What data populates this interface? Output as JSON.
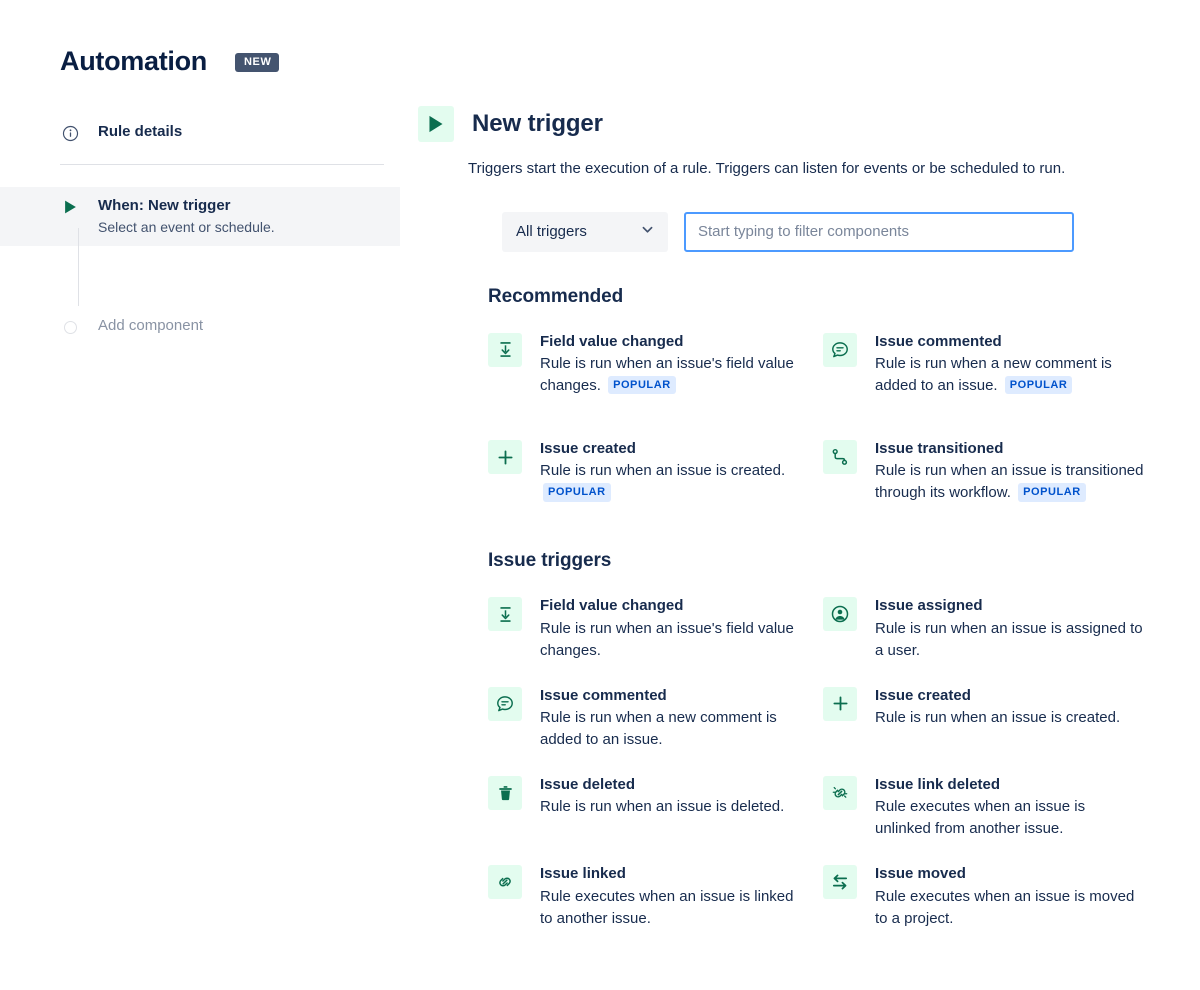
{
  "sidebar": {
    "app_title": "Automation",
    "new_badge": "NEW",
    "rule_details": {
      "label": "Rule details",
      "icon": "info-circle-icon"
    },
    "when_node": {
      "title": "When: New trigger",
      "subtitle": "Select an event or schedule.",
      "icon": "play-triangle-icon"
    },
    "add_component": {
      "label": "Add component",
      "icon": "empty-circle-icon"
    }
  },
  "main": {
    "title": "New trigger",
    "icon": "play-triangle-icon",
    "description": "Triggers start the execution of a rule. Triggers can listen for events or be scheduled to run.",
    "filter": {
      "select_value": "All triggers",
      "select_icon": "chevron-down-icon",
      "search_placeholder": "Start typing to filter components",
      "search_value": ""
    },
    "sections": [
      {
        "title": "Recommended",
        "items": [
          {
            "title": "Field value changed",
            "desc": "Rule is run when an issue's field value changes.",
            "badge": "POPULAR",
            "icon": "field-value-changed-icon"
          },
          {
            "title": "Issue commented",
            "desc": "Rule is run when a new comment is added to an issue.",
            "badge": "POPULAR",
            "icon": "comment-icon"
          },
          {
            "title": "Issue created",
            "desc": "Rule is run when an issue is created.",
            "badge": "POPULAR",
            "icon": "plus-icon"
          },
          {
            "title": "Issue transitioned",
            "desc": "Rule is run when an issue is transitioned through its workflow.",
            "badge": "POPULAR",
            "icon": "transition-icon"
          }
        ]
      },
      {
        "title": "Issue triggers",
        "items": [
          {
            "title": "Field value changed",
            "desc": "Rule is run when an issue's field value changes.",
            "badge": "",
            "icon": "field-value-changed-icon"
          },
          {
            "title": "Issue assigned",
            "desc": "Rule is run when an issue is assigned to a user.",
            "badge": "",
            "icon": "person-circle-icon"
          },
          {
            "title": "Issue commented",
            "desc": "Rule is run when a new comment is added to an issue.",
            "badge": "",
            "icon": "comment-icon"
          },
          {
            "title": "Issue created",
            "desc": "Rule is run when an issue is created.",
            "badge": "",
            "icon": "plus-icon"
          },
          {
            "title": "Issue deleted",
            "desc": "Rule is run when an issue is deleted.",
            "badge": "",
            "icon": "trash-icon"
          },
          {
            "title": "Issue link deleted",
            "desc": "Rule executes when an issue is unlinked from another issue.",
            "badge": "",
            "icon": "broken-link-icon"
          },
          {
            "title": "Issue linked",
            "desc": "Rule executes when an issue is linked to another issue.",
            "badge": "",
            "icon": "link-icon"
          },
          {
            "title": "Issue moved",
            "desc": "Rule executes when an issue is moved to a project.",
            "badge": "",
            "icon": "move-arrows-icon"
          }
        ]
      }
    ]
  },
  "colors": {
    "accent_green": "#0B6E4F",
    "icon_tile_bg": "#E3FCEF",
    "badge_new_bg": "#44546F",
    "badge_popular_bg": "#DEEBFF",
    "badge_popular_text": "#0052CC",
    "focus_border": "#4C9AFF",
    "text_primary": "#172B4D"
  }
}
